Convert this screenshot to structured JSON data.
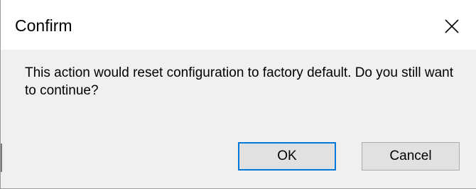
{
  "dialog": {
    "title": "Confirm",
    "close_icon": "close-icon",
    "message": "This action would reset configuration to factory default.  Do you still want to continue?",
    "buttons": {
      "ok_label": "OK",
      "cancel_label": "Cancel"
    },
    "colors": {
      "titlebar_bg": "#ffffff",
      "body_bg": "#f0f0f0",
      "button_bg": "#e1e1e1",
      "default_button_border": "#0078d7"
    }
  }
}
